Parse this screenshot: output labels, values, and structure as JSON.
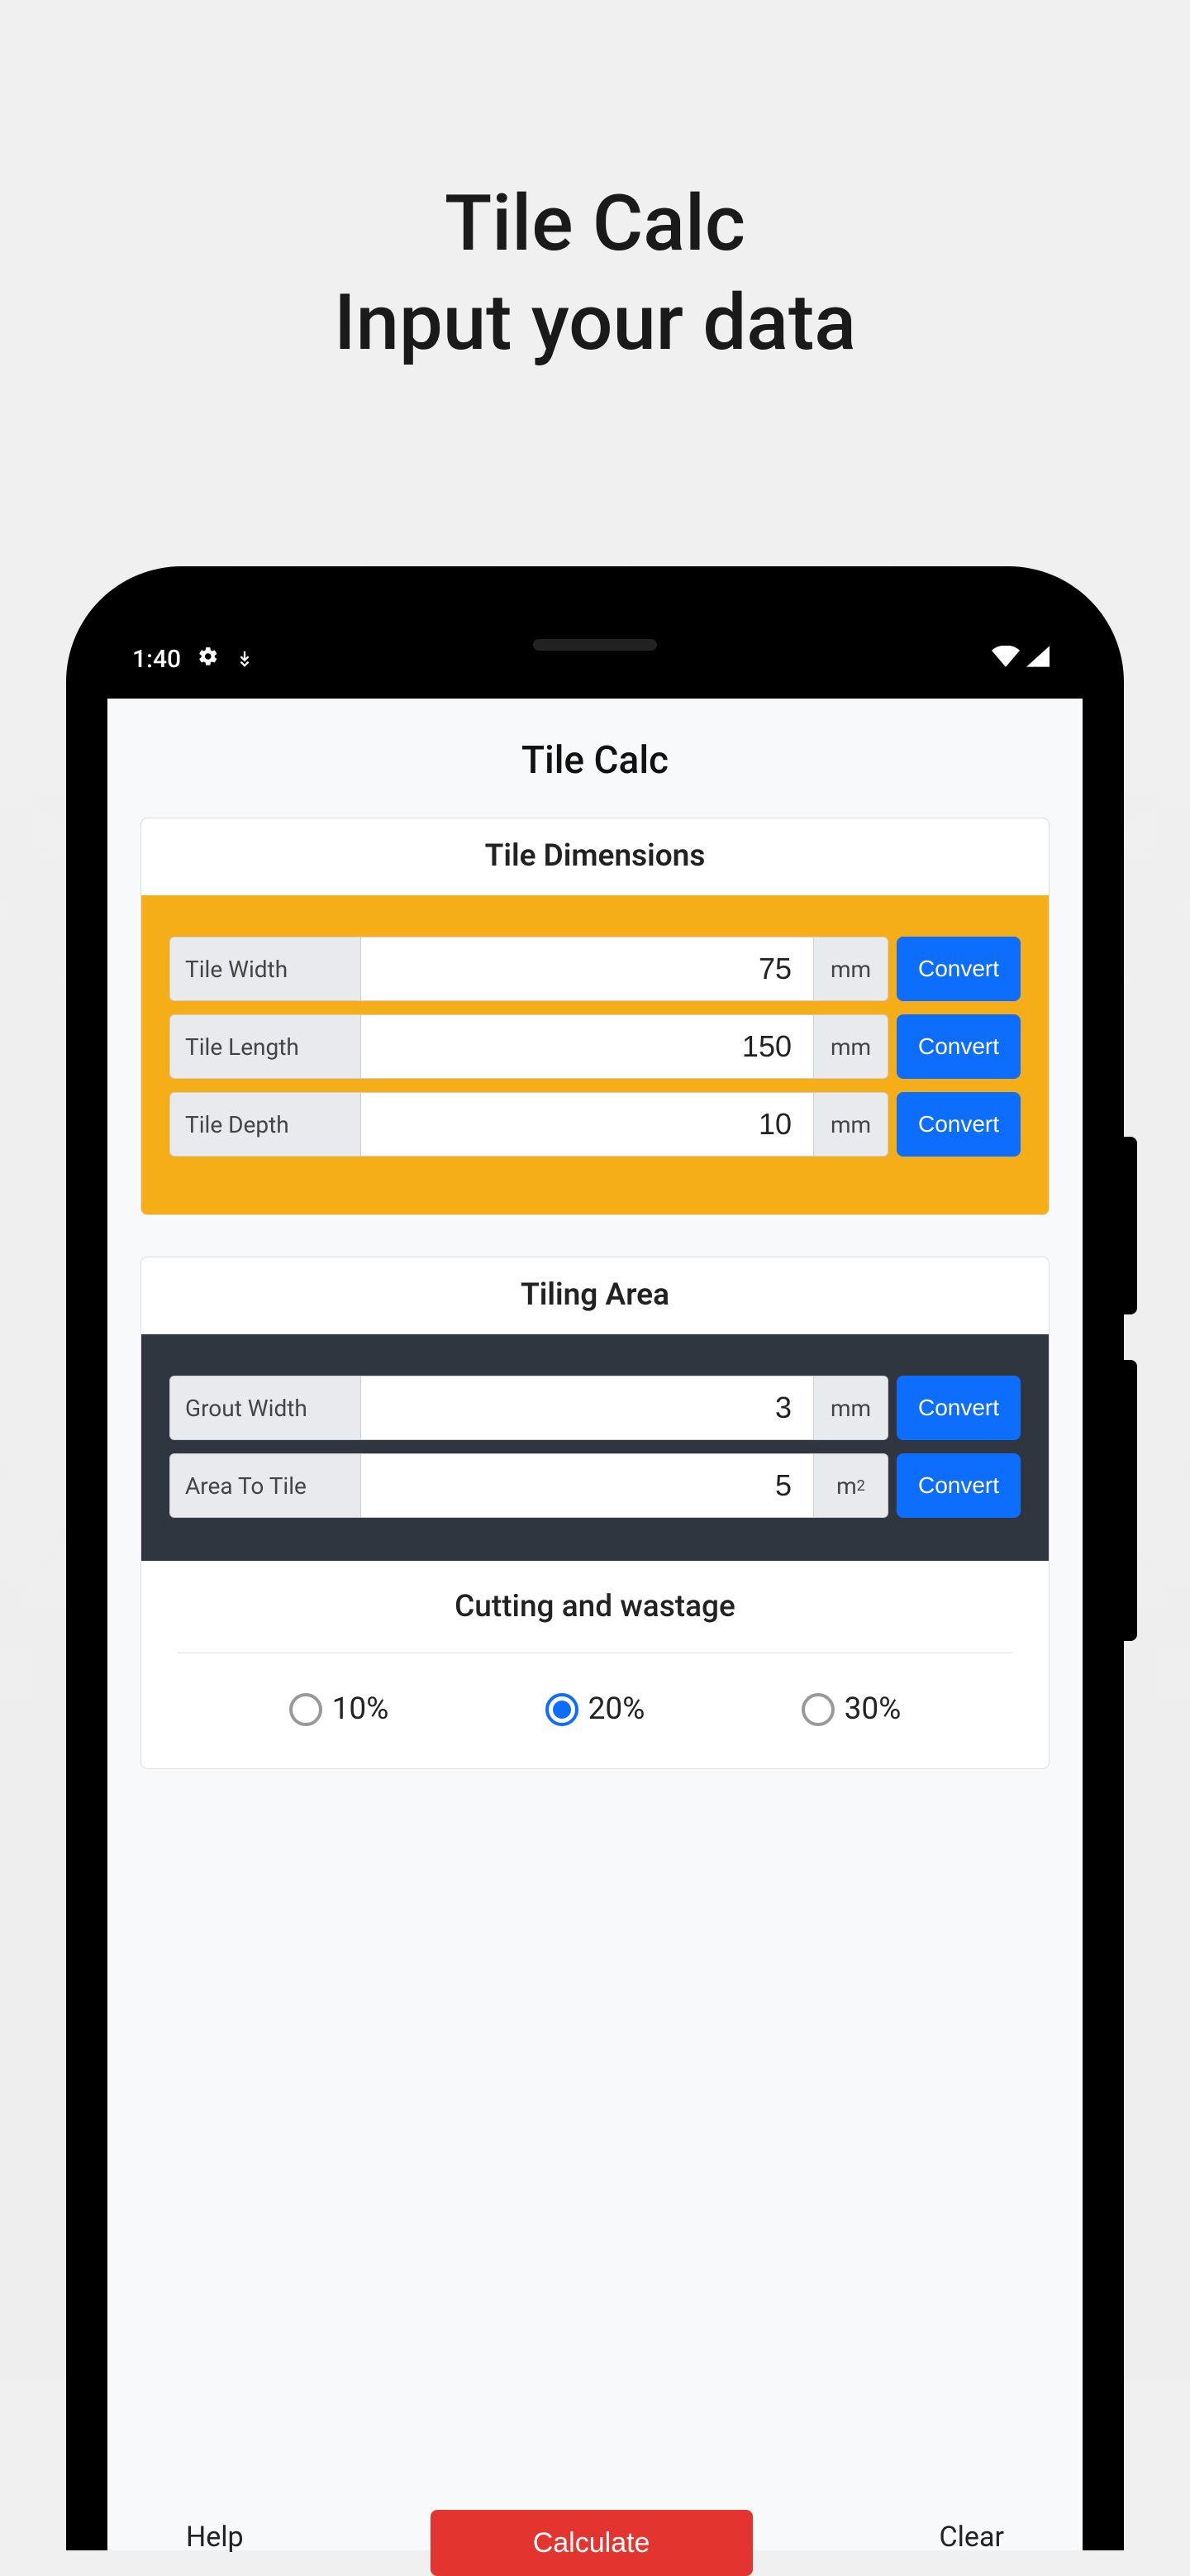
{
  "page": {
    "title_line1": "Tile Calc",
    "title_line2": "Input your data"
  },
  "statusbar": {
    "time": "1:40"
  },
  "app": {
    "title": "Tile Calc"
  },
  "tile_dimensions": {
    "title": "Tile Dimensions",
    "rows": [
      {
        "label": "Tile Width",
        "value": "75",
        "unit": "mm",
        "convert_label": "Convert"
      },
      {
        "label": "Tile Length",
        "value": "150",
        "unit": "mm",
        "convert_label": "Convert"
      },
      {
        "label": "Tile Depth",
        "value": "10",
        "unit": "mm",
        "convert_label": "Convert"
      }
    ]
  },
  "tiling_area": {
    "title": "Tiling Area",
    "rows": [
      {
        "label": "Grout Width",
        "value": "3",
        "unit": "mm",
        "convert_label": "Convert"
      },
      {
        "label": "Area To Tile",
        "value": "5",
        "unit": "m²",
        "convert_label": "Convert"
      }
    ]
  },
  "wastage": {
    "title": "Cutting and wastage",
    "options": [
      {
        "label": "10%",
        "selected": false
      },
      {
        "label": "20%",
        "selected": true
      },
      {
        "label": "30%",
        "selected": false
      }
    ]
  },
  "actions": {
    "help": "Help",
    "calculate": "Calculate",
    "clear": "Clear"
  }
}
